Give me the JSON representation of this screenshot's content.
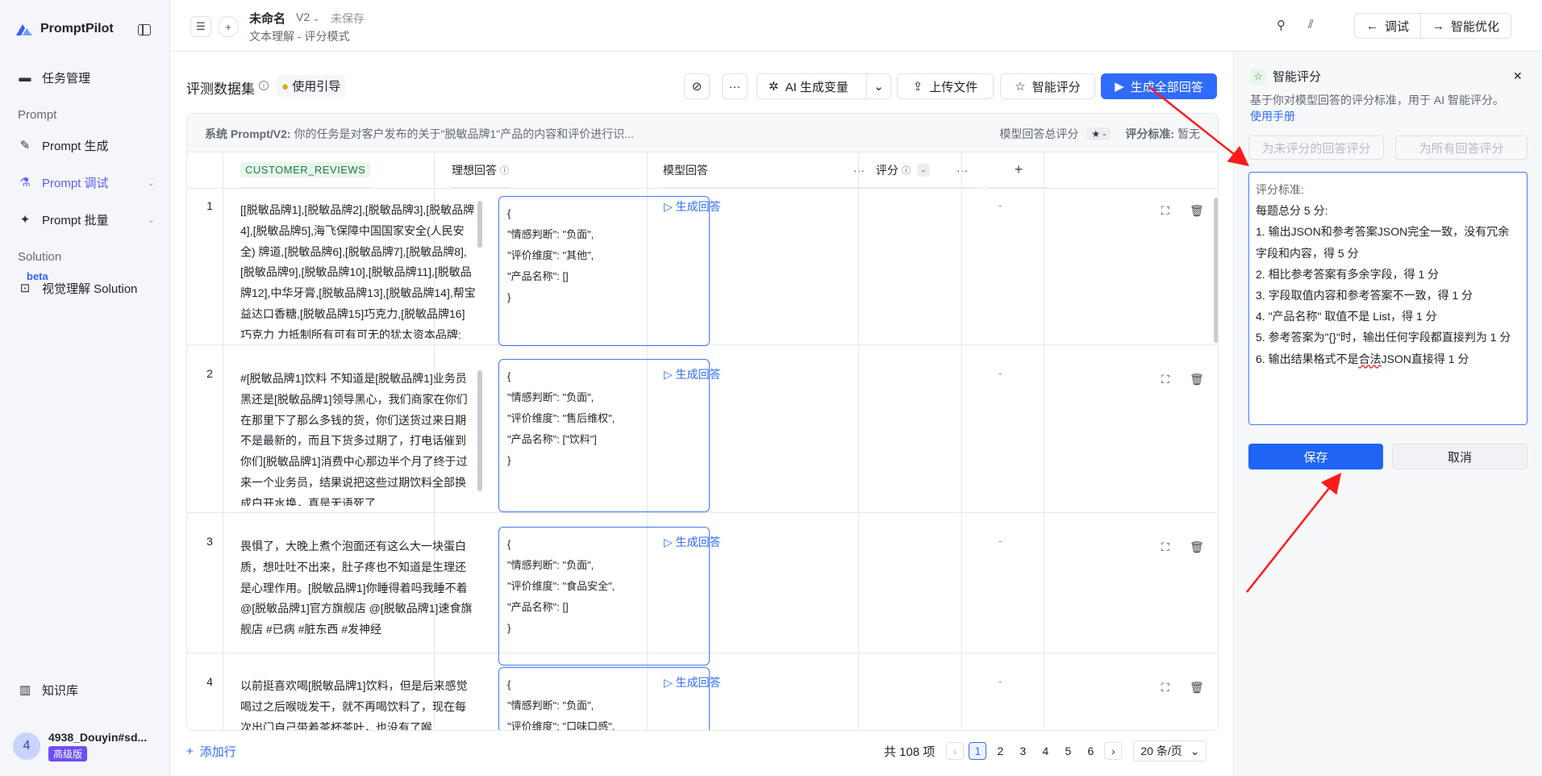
{
  "sidebar": {
    "brand": "PromptPilot",
    "items": [
      {
        "label": "任务管理",
        "icon": "folder-icon"
      },
      {
        "label": "Prompt 生成",
        "icon": "magic-wand-icon"
      },
      {
        "label": "Prompt 调试",
        "icon": "flask-icon"
      },
      {
        "label": "Prompt 批量",
        "icon": "batch-icon"
      },
      {
        "label": "视觉理解 Solution",
        "icon": "scan-icon"
      },
      {
        "label": "知识库",
        "icon": "book-icon"
      }
    ],
    "sections": [
      "Prompt",
      "Solution"
    ],
    "beta": "beta",
    "user": {
      "initial": "4",
      "name": "4938_Douyin#sd...",
      "badge": "高级版"
    }
  },
  "topbar": {
    "title": "未命名",
    "version": "V2",
    "status": "未保存",
    "subtitle": "文本理解 - 评分模式",
    "debug_label": "调试",
    "optimize_label": "智能优化"
  },
  "toolbar": {
    "title": "评测数据集",
    "guide": "使用引导",
    "ai_var": "AI 生成变量",
    "upload": "上传文件",
    "smart_score": "智能评分",
    "generate_all": "生成全部回答"
  },
  "sysbar": {
    "label": "系统 Prompt/V2:",
    "text": "你的任务是对客户发布的关于\"脱敏品牌1\"产品的内容和评价进行识...",
    "total_score": "模型回答总评分",
    "star_value": "★ -",
    "criteria_label": "评分标准:",
    "criteria_value": "暂无"
  },
  "table": {
    "columns": {
      "reviews": "CUSTOMER_REVIEWS",
      "ideal": "理想回答",
      "model": "模型回答",
      "score": "评分",
      "score_chip": "-"
    },
    "generate_label": "生成回答",
    "rows": [
      {
        "num": "1",
        "review": "[[脱敏品牌1],[脱敏品牌2],[脱敏品牌3],[脱敏品牌4],[脱敏品牌5],海飞保障中国国家安全(人民安全) 牌道,[脱敏品牌6],[脱敏品牌7],[脱敏品牌8],[脱敏品牌9],[脱敏品牌10],[脱敏品牌11],[脱敏品牌12],中华牙膏,[脱敏品牌13],[脱敏品牌14],帮宝益达口香糖,[脱敏品牌15]巧克力,[脱敏品牌16]巧克力 力抵制所有可有可无的犹太资本品牌;",
        "ideal": [
          "{",
          "\"情感判断\": \"负面\",",
          "\"评价维度\": \"其他\",",
          "\"产品名称\": []",
          "}"
        ],
        "score": "-"
      },
      {
        "num": "2",
        "review": "#[脱敏品牌1]饮料 不知道是[脱敏品牌1]业务员黑还是[脱敏品牌1]领导黑心，我们商家在你们在那里下了那么多钱的货，你们送货过来日期不是最新的，而且下货多过期了，打电话催到你们[脱敏品牌1]消费中心那边半个月了终于过来一个业务员，结果说把这些过期饮料全部换成白开水换，真是无语死了",
        "ideal": [
          "{",
          "\"情感判断\": \"负面\",",
          "\"评价维度\": \"售后维权\",",
          "\"产品名称\": [\"饮料\"]",
          "}"
        ],
        "score": "-"
      },
      {
        "num": "3",
        "review": "畏惧了，大晚上煮个泡面还有这么大一块蛋白质，想吐吐不出来，肚子疼也不知道是生理还是心理作用。[脱敏品牌1]你睡得着吗我睡不着 @[脱敏品牌1]官方旗舰店 @[脱敏品牌1]速食旗舰店 #已病 #脏东西 #发神经",
        "ideal": [
          "{",
          "\"情感判断\": \"负面\",",
          "\"评价维度\": \"食品安全\",",
          "\"产品名称\": []",
          "}"
        ],
        "score": "-"
      },
      {
        "num": "4",
        "review": "以前挺喜欢喝[脱敏品牌1]饮料，但是后来感觉喝过之后喉咙发干，就不再喝饮料了，现在每次出门自己带着茶杯茶叶，也没有了喉",
        "ideal": [
          "{",
          "\"情感判断\": \"负面\",",
          "\"评价维度\": \"口味口感\","
        ],
        "score": "-"
      }
    ]
  },
  "footer": {
    "add_row": "添加行",
    "total": "共 108 项",
    "pages": [
      "1",
      "2",
      "3",
      "4",
      "5",
      "6"
    ],
    "current_page": 1,
    "page_size": "20 条/页"
  },
  "panel": {
    "title": "智能评分",
    "desc": "基于你对模型回答的评分标准，用于 AI 智能评分。",
    "manual": "使用手册",
    "btn_unscored": "为未评分的回答评分",
    "btn_all": "为所有回答评分",
    "criteria": [
      "评分标准:",
      "每题总分 5 分:",
      "1. 输出JSON和参考答案JSON完全一致，没有冗余字段和内容，得 5 分",
      "2. 相比参考答案有多余字段，得 1 分",
      "3. 字段取值内容和参考答案不一致，得 1 分",
      "4. \"产品名称\" 取值不是 List，得 1 分",
      "5. 参考答案为\"{}\"时，输出任何字段都直接判为 1 分"
    ],
    "criteria_last_a": "6. 输出结果格式不是",
    "criteria_last_b": "合法",
    "criteria_last_c": "JSON直接得 1 分",
    "save": "保存",
    "cancel": "取消"
  },
  "colors": {
    "accent": "#2f6bff",
    "active_nav": "#5b5ff5",
    "annotation": "#ff1a1a"
  }
}
